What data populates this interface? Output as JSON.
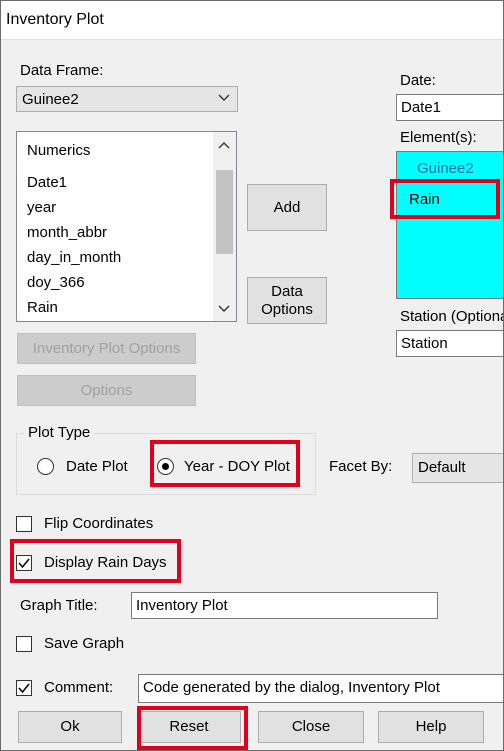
{
  "window": {
    "title": "Inventory Plot"
  },
  "data_frame": {
    "label": "Data Frame:",
    "selected": "Guinee2"
  },
  "variables": {
    "header": "Numerics",
    "items": [
      "Date1",
      "year",
      "month_abbr",
      "day_in_month",
      "doy_366",
      "Rain"
    ]
  },
  "buttons": {
    "add": "Add",
    "data_options_line1": "Data",
    "data_options_line2": "Options",
    "inventory_plot_options": "Inventory Plot Options",
    "options": "Options",
    "ok": "Ok",
    "reset": "Reset",
    "close": "Close",
    "help": "Help"
  },
  "date": {
    "label": "Date:",
    "value": "Date1"
  },
  "elements": {
    "label": "Element(s):",
    "group_name": "Guinee2",
    "items": [
      "Rain"
    ]
  },
  "station": {
    "label": "Station (Optional):",
    "value": "Station"
  },
  "plot_type": {
    "label": "Plot Type",
    "options": [
      "Date Plot",
      "Year - DOY Plot"
    ],
    "selected": "Year - DOY Plot"
  },
  "facet_by": {
    "label": "Facet By:",
    "selected": "Default"
  },
  "checks": {
    "flip_coordinates": {
      "label": "Flip Coordinates",
      "checked": false
    },
    "display_rain_days": {
      "label": "Display Rain Days",
      "checked": true
    },
    "save_graph": {
      "label": "Save Graph",
      "checked": false
    },
    "comment": {
      "label": "Comment:",
      "checked": true
    }
  },
  "graph_title": {
    "label": "Graph Title:",
    "value": "Inventory Plot"
  },
  "comment_text": {
    "value": "Code generated by the dialog, Inventory Plot"
  },
  "colors": {
    "highlight": "#e0001b",
    "selected_receiver": "#00ffff"
  }
}
